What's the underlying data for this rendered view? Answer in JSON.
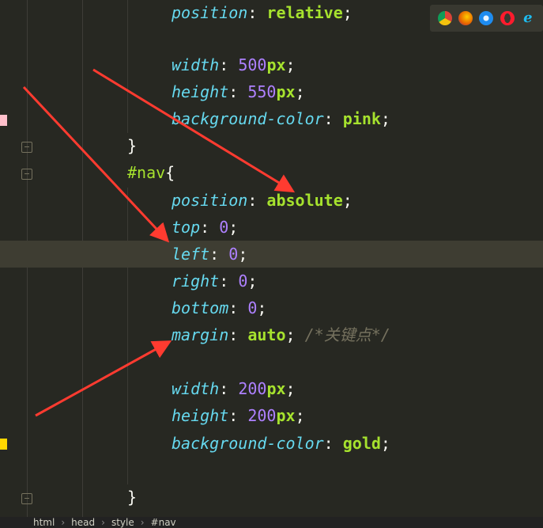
{
  "colors": {
    "background": "#272822",
    "property": "#66d9ef",
    "keyword": "#a6e22e",
    "number": "#ae81ff",
    "comment": "#75715e",
    "arrow": "#ff3b30"
  },
  "lines": [
    [
      {
        "t": "position",
        "c": "prop"
      },
      {
        "t": ": ",
        "c": "pun"
      },
      {
        "t": "relative",
        "c": "kw"
      },
      {
        "t": ";",
        "c": "pun"
      }
    ],
    [],
    [
      {
        "t": "width",
        "c": "prop"
      },
      {
        "t": ": ",
        "c": "pun"
      },
      {
        "t": "500",
        "c": "num"
      },
      {
        "t": "px",
        "c": "unit"
      },
      {
        "t": ";",
        "c": "pun"
      }
    ],
    [
      {
        "t": "height",
        "c": "prop"
      },
      {
        "t": ": ",
        "c": "pun"
      },
      {
        "t": "550",
        "c": "num"
      },
      {
        "t": "px",
        "c": "unit"
      },
      {
        "t": ";",
        "c": "pun"
      }
    ],
    [
      {
        "t": "background-color",
        "c": "prop"
      },
      {
        "t": ": ",
        "c": "pun"
      },
      {
        "t": "pink",
        "c": "kw"
      },
      {
        "t": ";",
        "c": "pun"
      }
    ],
    [
      {
        "t": "}",
        "c": "pun"
      }
    ],
    [
      {
        "t": "#nav",
        "c": "sel"
      },
      {
        "t": "{",
        "c": "pun"
      }
    ],
    [
      {
        "t": "position",
        "c": "prop"
      },
      {
        "t": ": ",
        "c": "pun"
      },
      {
        "t": "absolute",
        "c": "kw"
      },
      {
        "t": ";",
        "c": "pun"
      }
    ],
    [
      {
        "t": "top",
        "c": "prop"
      },
      {
        "t": ": ",
        "c": "pun"
      },
      {
        "t": "0",
        "c": "num"
      },
      {
        "t": ";",
        "c": "pun"
      }
    ],
    [
      {
        "t": "left",
        "c": "prop"
      },
      {
        "t": ": ",
        "c": "pun"
      },
      {
        "t": "0",
        "c": "num"
      },
      {
        "t": ";",
        "c": "pun"
      }
    ],
    [
      {
        "t": "right",
        "c": "prop"
      },
      {
        "t": ": ",
        "c": "pun"
      },
      {
        "t": "0",
        "c": "num"
      },
      {
        "t": ";",
        "c": "pun"
      }
    ],
    [
      {
        "t": "bottom",
        "c": "prop"
      },
      {
        "t": ": ",
        "c": "pun"
      },
      {
        "t": "0",
        "c": "num"
      },
      {
        "t": ";",
        "c": "pun"
      }
    ],
    [
      {
        "t": "margin",
        "c": "prop"
      },
      {
        "t": ": ",
        "c": "pun"
      },
      {
        "t": "auto",
        "c": "kw"
      },
      {
        "t": "; ",
        "c": "pun"
      },
      {
        "t": "/*关键点*/",
        "c": "cmt"
      }
    ],
    [],
    [
      {
        "t": "width",
        "c": "prop"
      },
      {
        "t": ": ",
        "c": "pun"
      },
      {
        "t": "200",
        "c": "num"
      },
      {
        "t": "px",
        "c": "unit"
      },
      {
        "t": ";",
        "c": "pun"
      }
    ],
    [
      {
        "t": "height",
        "c": "prop"
      },
      {
        "t": ": ",
        "c": "pun"
      },
      {
        "t": "200",
        "c": "num"
      },
      {
        "t": "px",
        "c": "unit"
      },
      {
        "t": ";",
        "c": "pun"
      }
    ],
    [
      {
        "t": "background-color",
        "c": "prop"
      },
      {
        "t": ": ",
        "c": "pun"
      },
      {
        "t": "gold",
        "c": "kw"
      },
      {
        "t": ";",
        "c": "pun"
      }
    ],
    [],
    [
      {
        "t": "}",
        "c": "pun"
      }
    ]
  ],
  "color_markers": [
    "pink",
    "gold"
  ],
  "browser_icons": [
    "chrome-icon",
    "firefox-icon",
    "safari-icon",
    "opera-icon",
    "ie-icon"
  ],
  "breadcrumb": [
    "html",
    "head",
    "style",
    "#nav"
  ]
}
